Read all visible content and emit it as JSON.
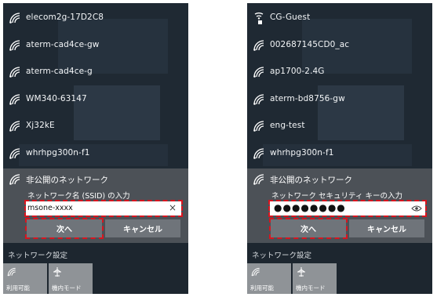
{
  "left_panel": {
    "networks": [
      {
        "name": "elecom2g-17D2C8",
        "icon": "wifi-icon"
      },
      {
        "name": "aterm-cad4ce-gw",
        "icon": "wifi-icon"
      },
      {
        "name": "aterm-cad4ce-g",
        "icon": "wifi-icon"
      },
      {
        "name": "WM340-63147",
        "icon": "wifi-icon"
      },
      {
        "name": "Xj32kE",
        "icon": "wifi-icon"
      },
      {
        "name": "whrhpg300n-f1",
        "icon": "wifi-icon"
      }
    ],
    "selected": {
      "title": "非公開のネットワーク",
      "prompt": "ネットワーク名 (SSID) の入力",
      "input_value": "msone-xxxx",
      "clear_glyph": "×",
      "next_label": "次へ",
      "cancel_label": "キャンセル"
    },
    "footer": {
      "settings_label": "ネットワーク設定",
      "tiles": [
        {
          "label": "利用可能",
          "icon": "wifi-icon"
        },
        {
          "label": "機内モード",
          "icon": "airplane-icon"
        }
      ]
    }
  },
  "right_panel": {
    "networks": [
      {
        "name": "CG-Guest",
        "icon": "wifi-secured-icon"
      },
      {
        "name": "002687145CD0_ac",
        "icon": "wifi-icon"
      },
      {
        "name": "ap1700-2.4G",
        "icon": "wifi-icon"
      },
      {
        "name": "aterm-bd8756-gw",
        "icon": "wifi-icon"
      },
      {
        "name": "eng-test",
        "icon": "wifi-icon"
      },
      {
        "name": "whrhpg300n-f1",
        "icon": "wifi-icon"
      }
    ],
    "selected": {
      "title": "非公開のネットワーク",
      "prompt": "ネットワーク セキュリティ キーの入力",
      "password_mask": "●●●●●●●●",
      "next_label": "次へ",
      "cancel_label": "キャンセル"
    },
    "footer": {
      "settings_label": "ネットワーク設定",
      "tiles": [
        {
          "label": "利用可能",
          "icon": "wifi-icon"
        },
        {
          "label": "機内モード",
          "icon": "airplane-icon"
        }
      ]
    }
  },
  "colors": {
    "panel_bg": "#1f2933",
    "selected_bg": "#4c5157",
    "button_bg": "#6f747a",
    "highlight": "#d8141e"
  }
}
